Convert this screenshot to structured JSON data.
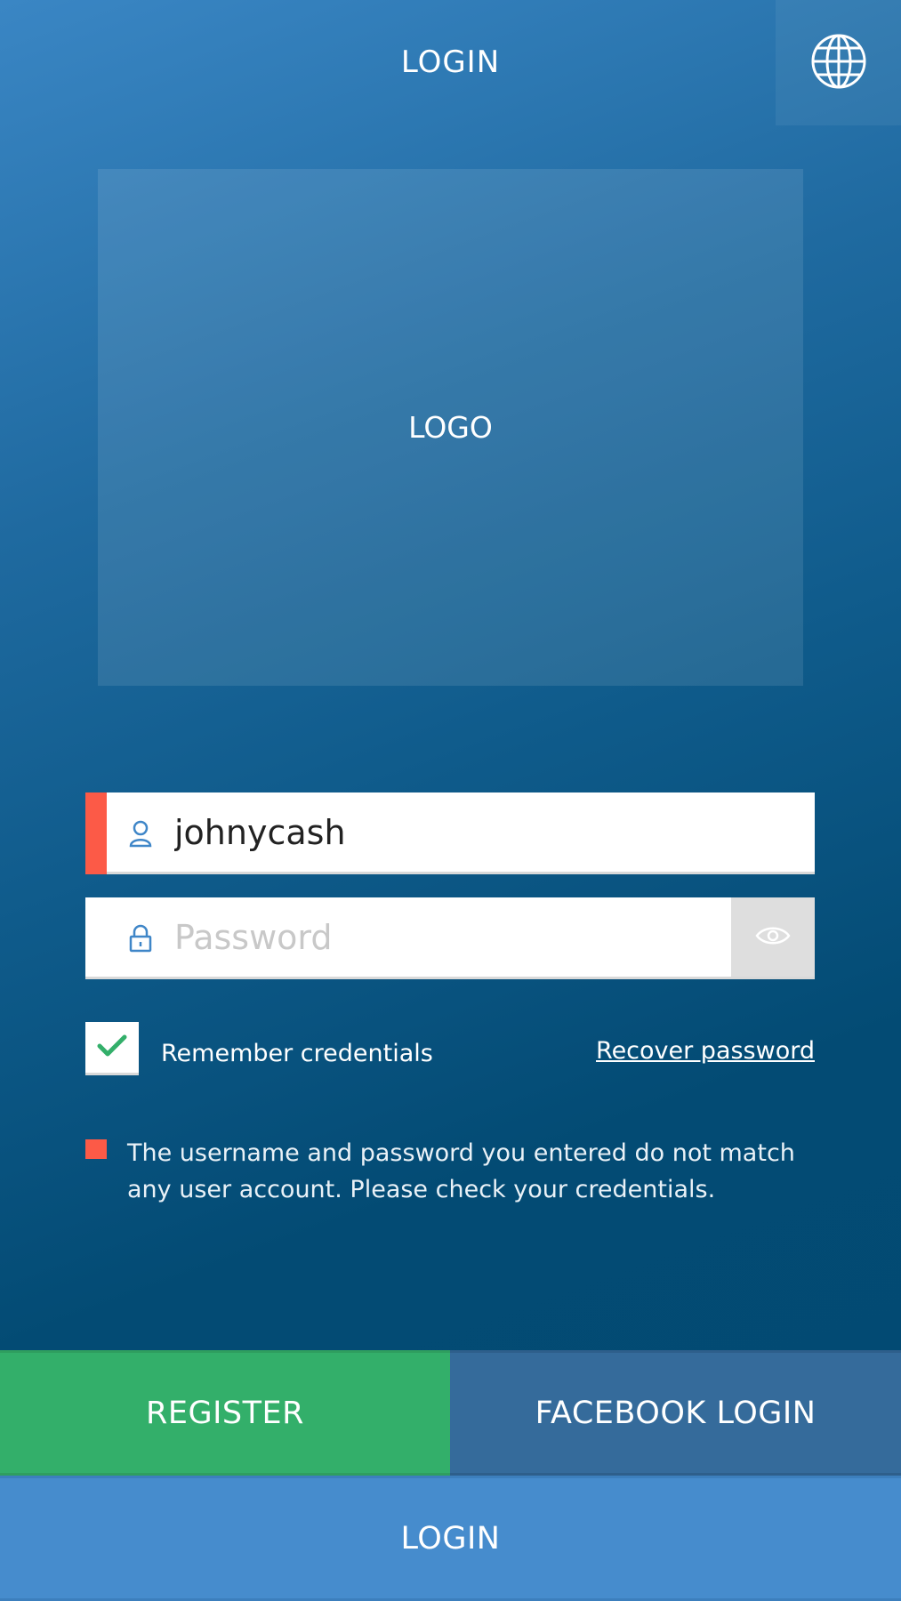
{
  "header": {
    "title": "LOGIN",
    "language_icon": "globe-icon"
  },
  "logo": {
    "text": "LOGO"
  },
  "username": {
    "value": "johnycash",
    "icon": "user-icon",
    "has_error": true
  },
  "password": {
    "placeholder": "Password",
    "value": "",
    "icon": "lock-icon",
    "toggle_icon": "eye-icon"
  },
  "remember": {
    "label": "Remember credentials",
    "checked": true,
    "icon": "checkmark-icon"
  },
  "recover": {
    "label": "Recover password"
  },
  "error": {
    "message": "The username and password you entered do not match any user account. Please check your credentials."
  },
  "buttons": {
    "register": "REGISTER",
    "facebook": "FACEBOOK LOGIN",
    "login": "LOGIN"
  },
  "colors": {
    "error": "#fc5a47",
    "register": "#33af6a",
    "facebook": "#356b9b",
    "login": "#468ccd",
    "icon_blue": "#3f86c8"
  }
}
